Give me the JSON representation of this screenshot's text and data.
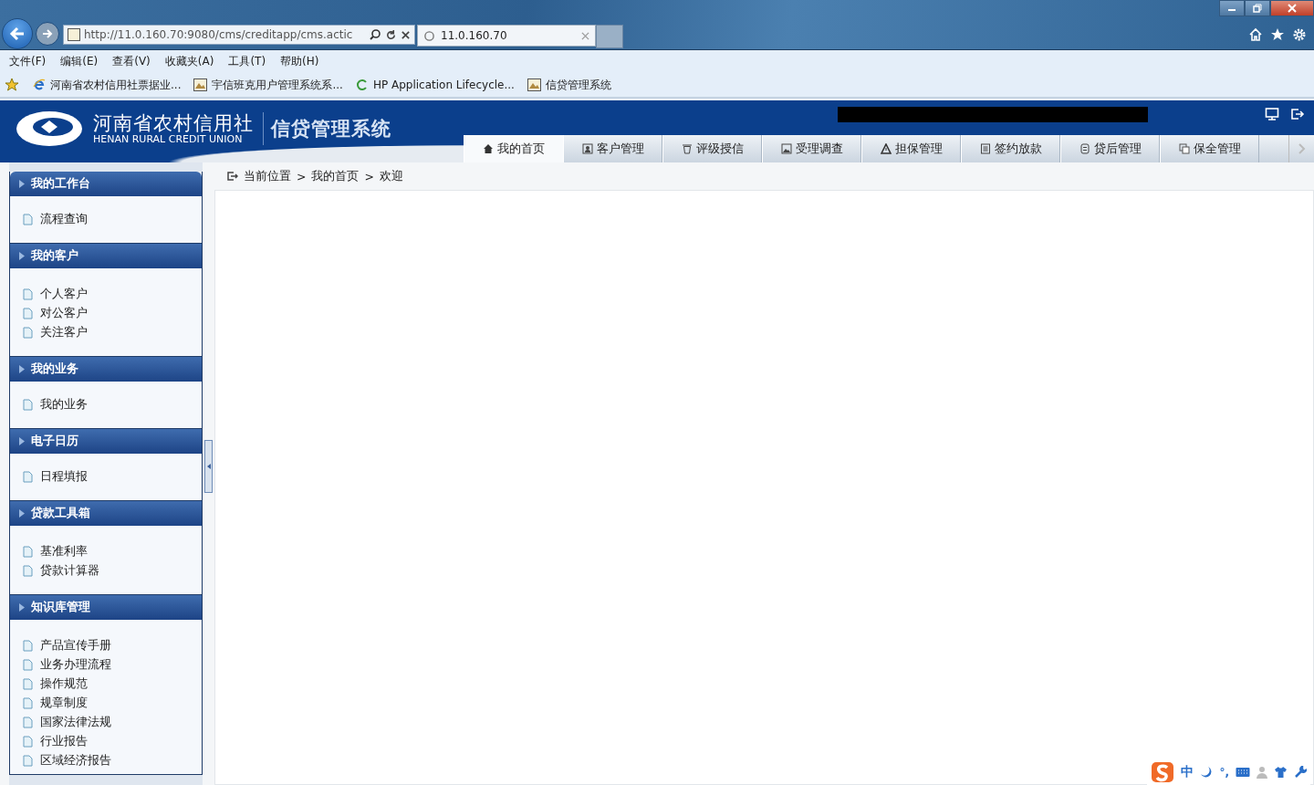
{
  "browser": {
    "url": "http://11.0.160.70:9080/cms/creditapp/cms.actic",
    "tabs": [
      {
        "title": "11.0.160.70",
        "selected": true
      }
    ],
    "menu": [
      "文件(F)",
      "编辑(E)",
      "查看(V)",
      "收藏夹(A)",
      "工具(T)",
      "帮助(H)"
    ],
    "favorites": [
      {
        "kind": "ie",
        "label": "河南省农村信用社票据业..."
      },
      {
        "kind": "page",
        "label": "宇信班克用户管理系统系..."
      },
      {
        "kind": "hp",
        "label": "HP Application Lifecycle..."
      },
      {
        "kind": "page",
        "label": "信贷管理系统"
      }
    ]
  },
  "header": {
    "org_name": "河南省农村信用社",
    "org_name_en": "HENAN RURAL CREDIT UNION",
    "system_name": "信贷管理系统",
    "nav_tabs": [
      {
        "label": "我的首页",
        "selected": true
      },
      {
        "label": "客户管理",
        "selected": false
      },
      {
        "label": "评级授信",
        "selected": false
      },
      {
        "label": "受理调查",
        "selected": false
      },
      {
        "label": "担保管理",
        "selected": false
      },
      {
        "label": "签约放款",
        "selected": false
      },
      {
        "label": "贷后管理",
        "selected": false
      },
      {
        "label": "保全管理",
        "selected": false
      }
    ]
  },
  "breadcrumb": [
    "当前位置",
    ">",
    "我的首页",
    ">",
    "欢迎"
  ],
  "sidebar": [
    {
      "title": "我的工作台",
      "items": [
        "流程查询"
      ]
    },
    {
      "title": "我的客户",
      "items": [
        "个人客户",
        "对公客户",
        "关注客户"
      ]
    },
    {
      "title": "我的业务",
      "items": [
        "我的业务"
      ]
    },
    {
      "title": "电子日历",
      "items": [
        "日程填报"
      ]
    },
    {
      "title": "贷款工具箱",
      "items": [
        "基准利率",
        "贷款计算器"
      ]
    },
    {
      "title": "知识库管理",
      "items": [
        "产品宣传手册",
        "业务办理流程",
        "操作规范",
        "规章制度",
        "国家法律法规",
        "行业报告",
        "区域经济报告"
      ]
    }
  ],
  "ime": {
    "mode": "中",
    "punct": "°,"
  }
}
